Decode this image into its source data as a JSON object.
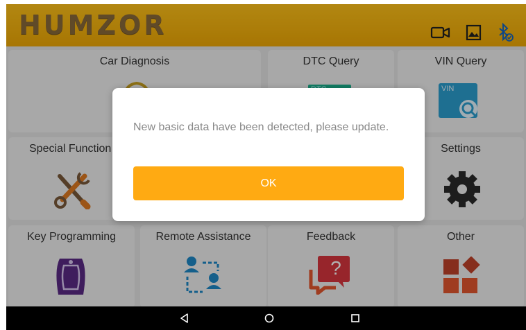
{
  "topbar": {
    "logo": "HUMZOR",
    "icons": [
      "video-camera-icon",
      "gallery-icon",
      "bluetooth-icon"
    ]
  },
  "tiles": {
    "car_diagnosis": "Car Diagnosis",
    "dtc_query": "DTC Query",
    "dtc_badge": "DTC",
    "vin_query": "VIN Query",
    "vin_badge": "VIN",
    "special_function": "Special Function",
    "settings": "Settings",
    "key_programming": "Key Programming",
    "remote_assistance": "Remote Assistance",
    "feedback": "Feedback",
    "feedback_glyph": "?",
    "other": "Other"
  },
  "dialog": {
    "message": "New basic data have been detected, please update.",
    "ok_label": "OK"
  },
  "navbar": {
    "buttons": [
      "back-icon",
      "home-icon",
      "recents-icon"
    ]
  },
  "colors": {
    "topbar": "#f5b30a",
    "accent_orange": "#ffaa12",
    "teal": "#1ea0c8",
    "purple": "#5b2a86",
    "red": "#d9363e",
    "dark_orange": "#e4572e"
  }
}
